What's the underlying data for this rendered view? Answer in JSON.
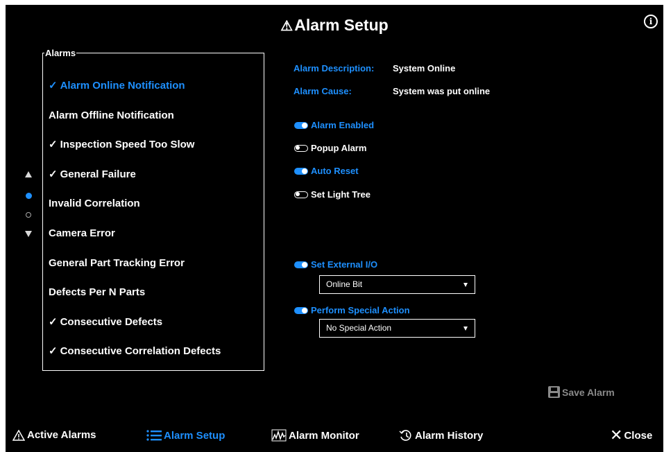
{
  "window": {
    "title": "Alarm Setup",
    "title_icon": "warning-triangle-icon"
  },
  "alarms": {
    "legend": "Alarms",
    "check_mark": "✓",
    "items": [
      {
        "label": "Alarm Online Notification",
        "checked": true,
        "selected": true
      },
      {
        "label": "Alarm Offline Notification",
        "checked": false,
        "selected": false
      },
      {
        "label": "Inspection Speed Too Slow",
        "checked": true,
        "selected": false
      },
      {
        "label": "General Failure",
        "checked": true,
        "selected": false
      },
      {
        "label": "Invalid Correlation",
        "checked": false,
        "selected": false
      },
      {
        "label": "Camera Error",
        "checked": false,
        "selected": false
      },
      {
        "label": "General Part Tracking Error",
        "checked": false,
        "selected": false
      },
      {
        "label": "Defects Per N Parts",
        "checked": false,
        "selected": false
      },
      {
        "label": "Consecutive Defects",
        "checked": true,
        "selected": false
      },
      {
        "label": "Consecutive Correlation Defects",
        "checked": true,
        "selected": false
      }
    ],
    "pager": {
      "pages": 2,
      "current_page": 1
    }
  },
  "details": {
    "description_label": "Alarm Description:",
    "description_value": "System Online",
    "cause_label": "Alarm Cause:",
    "cause_value": "System was put online"
  },
  "toggles": {
    "alarm_enabled": {
      "label": "Alarm Enabled",
      "on": true
    },
    "popup_alarm": {
      "label": "Popup Alarm",
      "on": false
    },
    "auto_reset": {
      "label": "Auto Reset",
      "on": true
    },
    "set_light_tree": {
      "label": "Set Light Tree",
      "on": false
    },
    "set_external_io": {
      "label": "Set External I/O",
      "on": true
    },
    "perform_special_action": {
      "label": "Perform Special Action",
      "on": true
    }
  },
  "external_io_select": {
    "value": "Online Bit"
  },
  "special_action_select": {
    "value": "No Special Action"
  },
  "save_button": {
    "label": "Save Alarm",
    "enabled": false
  },
  "bottom_nav": {
    "active_alarms": "Active Alarms",
    "alarm_setup": "Alarm Setup",
    "alarm_monitor": "Alarm Monitor",
    "alarm_history": "Alarm History",
    "close": "Close"
  },
  "colors": {
    "accent": "#1e90ff",
    "background": "#000000",
    "text": "#ffffff",
    "disabled": "#8a8a8a"
  }
}
